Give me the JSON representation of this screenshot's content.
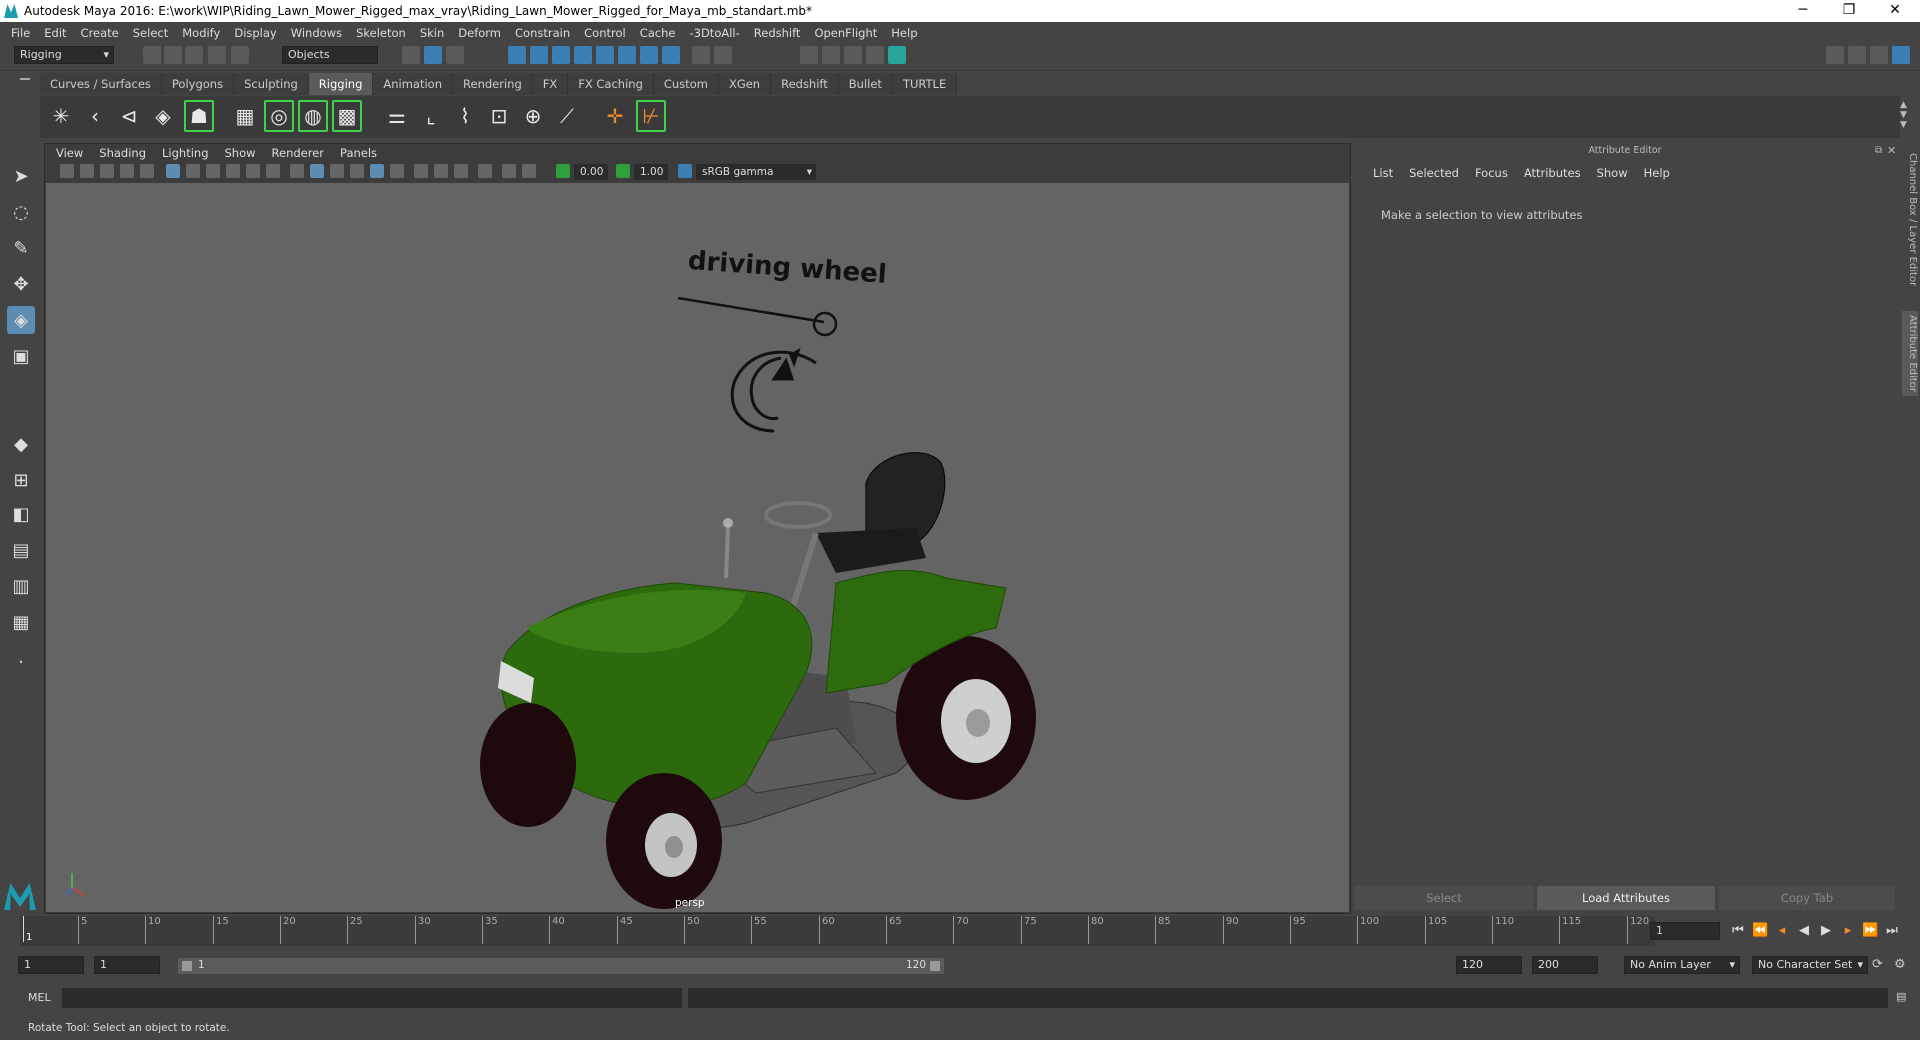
{
  "window": {
    "title": "Autodesk Maya 2016: E:\\work\\WIP\\Riding_Lawn_Mower_Rigged_max_vray\\Riding_Lawn_Mower_Rigged_for_Maya_mb_standart.mb*"
  },
  "menus": [
    "File",
    "Edit",
    "Create",
    "Select",
    "Modify",
    "Display",
    "Windows",
    "Skeleton",
    "Skin",
    "Deform",
    "Constrain",
    "Control",
    "Cache",
    "-3DtoAll-",
    "Redshift",
    "OpenFlight",
    "Help"
  ],
  "status": {
    "menuset": "Rigging",
    "selection_mask": "Objects"
  },
  "shelf_tabs": [
    "Curves / Surfaces",
    "Polygons",
    "Sculpting",
    "Rigging",
    "Animation",
    "Rendering",
    "FX",
    "FX Caching",
    "Custom",
    "XGen",
    "Redshift",
    "Bullet",
    "TURTLE"
  ],
  "active_shelf_tab": "Rigging",
  "panel_menu": [
    "View",
    "Shading",
    "Lighting",
    "Show",
    "Renderer",
    "Panels"
  ],
  "panel_toolbar": {
    "exposure": "0.00",
    "gamma": "1.00",
    "color_space": "sRGB gamma"
  },
  "viewport": {
    "camera": "persp",
    "annotation": "driving wheel"
  },
  "attribute_editor": {
    "title": "Attribute Editor",
    "menu": [
      "List",
      "Selected",
      "Focus",
      "Attributes",
      "Show",
      "Help"
    ],
    "message": "Make a selection to view attributes",
    "buttons": {
      "select": "Select",
      "load": "Load Attributes",
      "copy_tab": "Copy Tab"
    }
  },
  "side_tabs": {
    "channel_box": "Channel Box / Layer Editor",
    "attribute_editor": "Attribute Editor"
  },
  "timeline": {
    "tick_labels": [
      "5",
      "10",
      "15",
      "20",
      "25",
      "30",
      "35",
      "40",
      "45",
      "50",
      "55",
      "60",
      "65",
      "70",
      "75",
      "80",
      "85",
      "90",
      "95",
      "100",
      "105",
      "110",
      "115",
      "120"
    ],
    "start_label": "1",
    "current_frame": "1"
  },
  "range": {
    "start": "1",
    "playback_start": "1",
    "slider_start": "1",
    "slider_end": "120",
    "playback_end": "120",
    "end": "200",
    "anim_layer": "No Anim Layer",
    "character_set": "No Character Set"
  },
  "command_line": {
    "lang": "MEL"
  },
  "help_line": "Rotate Tool: Select an object to rotate."
}
